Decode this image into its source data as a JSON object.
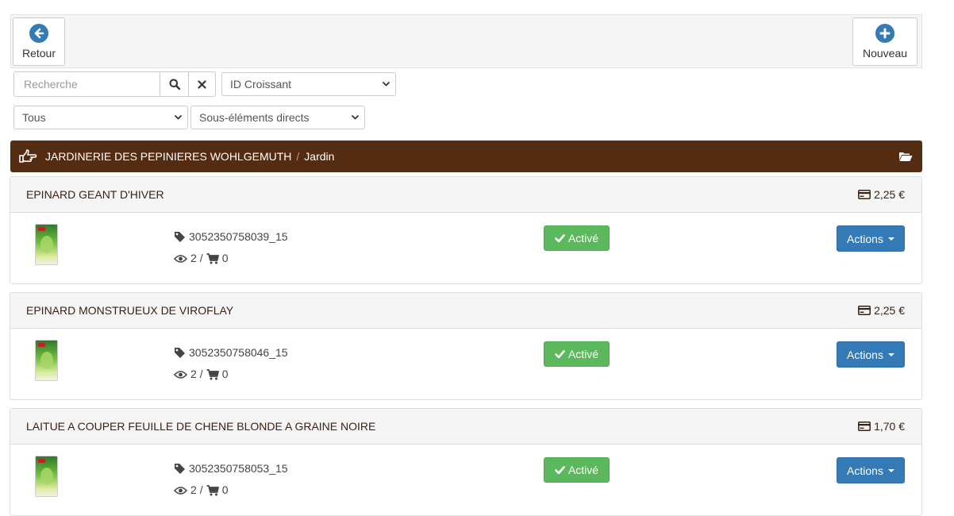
{
  "toolbar": {
    "back_label": "Retour",
    "new_label": "Nouveau"
  },
  "search": {
    "placeholder": "Recherche",
    "value": ""
  },
  "filters": {
    "sort": "ID Croissant",
    "scope": "Tous",
    "depth": "Sous-éléments directs"
  },
  "breadcrumb": {
    "root": "JARDINERIE DES PEPINIERES WOHLGEMUTH",
    "separator": "/",
    "current": "Jardin"
  },
  "products": [
    {
      "name": "EPINARD GEANT D'HIVER",
      "price": "2,25 €",
      "sku": "3052350758039_15",
      "views": "2",
      "sep": "/",
      "carts": "0",
      "status": "Activé",
      "actions_label": "Actions"
    },
    {
      "name": "EPINARD MONSTRUEUX DE VIROFLAY",
      "price": "2,25 €",
      "sku": "3052350758046_15",
      "views": "2",
      "sep": "/",
      "carts": "0",
      "status": "Activé",
      "actions_label": "Actions"
    },
    {
      "name": "LAITUE A COUPER FEUILLE DE CHENE BLONDE A GRAINE NOIRE",
      "price": "1,70 €",
      "sku": "3052350758053_15",
      "views": "2",
      "sep": "/",
      "carts": "0",
      "status": "Activé",
      "actions_label": "Actions"
    }
  ],
  "colors": {
    "accent": "#337ab7",
    "breadcrumb_bg": "#532c12",
    "success": "#5cb85c"
  }
}
